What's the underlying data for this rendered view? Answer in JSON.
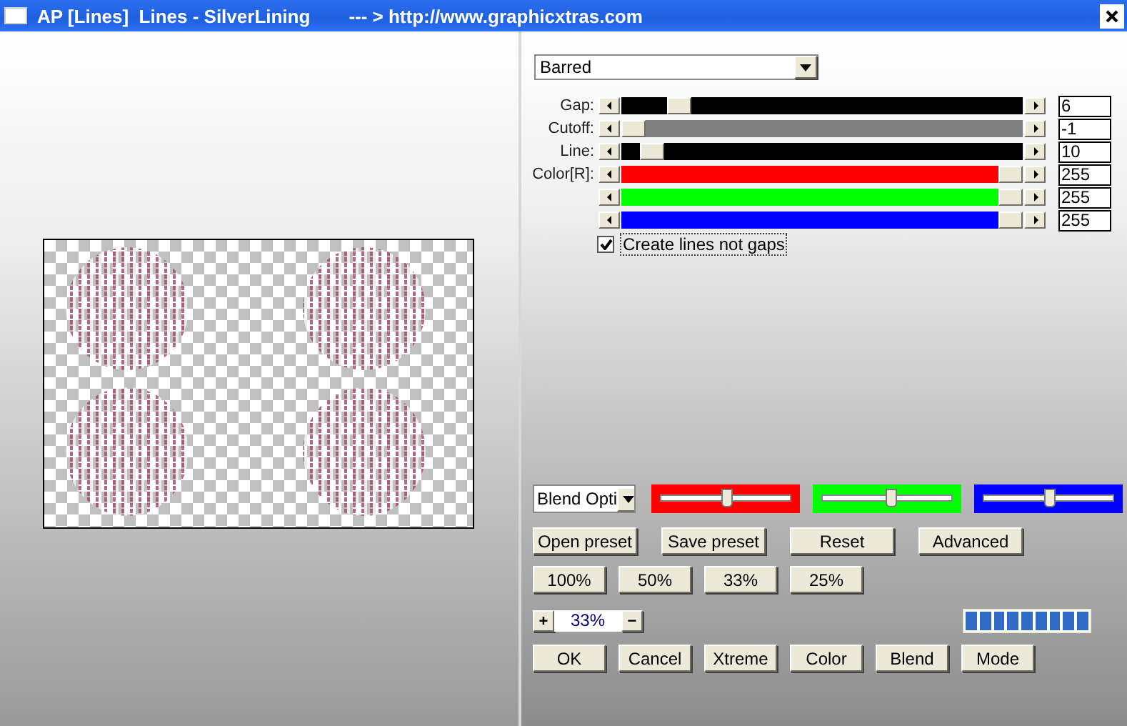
{
  "window": {
    "title": "AP [Lines]  Lines - SilverLining",
    "subtitle": "--- > http://www.graphicxtras.com"
  },
  "mode_dropdown": {
    "value": "Barred"
  },
  "sliders": [
    {
      "label": "Gap:",
      "level": 0.12,
      "color": "#000000",
      "value": "6"
    },
    {
      "label": "Cutoff:",
      "level": 0.0,
      "color": "#808080",
      "value": "-1"
    },
    {
      "label": "Line:",
      "level": 0.05,
      "color": "#000000",
      "value": "10"
    },
    {
      "label": "Color[R]:",
      "level": 1.0,
      "color": "#ff0000",
      "value": "255"
    },
    {
      "level": 1.0,
      "color": "#00ff00",
      "value": "255"
    },
    {
      "level": 1.0,
      "color": "#0000ff",
      "value": "255"
    }
  ],
  "checkbox": {
    "label": "Create lines not gaps",
    "checked": true
  },
  "blend_dropdown": {
    "value": "Blend Opti"
  },
  "blend_sliders": [
    {
      "level": 0.5,
      "color": "#ff0000"
    },
    {
      "level": 0.52,
      "color": "#00ff00"
    },
    {
      "level": 0.5,
      "color": "#0000ff"
    }
  ],
  "preset_buttons": [
    "Open preset",
    "Save preset",
    "Reset",
    "Advanced"
  ],
  "zoom_buttons": [
    "100%",
    "50%",
    "33%",
    "25%"
  ],
  "zoom": {
    "plus": "+",
    "value": "33%",
    "minus": "−"
  },
  "progress": {
    "level": 1
  },
  "bottom_buttons": [
    "OK",
    "Cancel",
    "Xtreme",
    "Color",
    "Blend",
    "Mode"
  ]
}
